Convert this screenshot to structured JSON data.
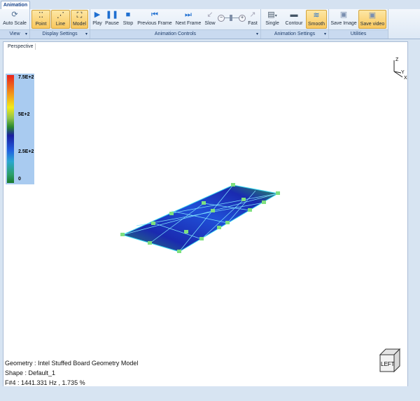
{
  "tab": {
    "label": "Animation"
  },
  "groups": {
    "view": {
      "label": "View",
      "auto_scale": "Auto Scale"
    },
    "display": {
      "label": "Display Settings",
      "point": "Point",
      "line": "Line",
      "model": "Model"
    },
    "animation": {
      "label": "Animation Controls",
      "play": "Play",
      "pause": "Pause",
      "stop": "Stop",
      "previous": "Previous Frame",
      "next": "Next Frame",
      "slow": "Slow",
      "fast": "Fast"
    },
    "anim_settings": {
      "label": "Animation Settings",
      "single": "Single",
      "contour": "Contour",
      "smooth": "Smooth"
    },
    "utilities": {
      "label": "Utilities",
      "save_image": "Save Image",
      "save_video": "Save video"
    }
  },
  "viewport": {
    "tab": "Perspective"
  },
  "legend": {
    "ticks": [
      "7.5E+2",
      "5E+2",
      "2.5E+2",
      "0"
    ]
  },
  "axes": {
    "z": "Z",
    "y": "Y",
    "x": "X"
  },
  "cube": {
    "face": "LEFT"
  },
  "info": {
    "geometry": "Geometry : Intel Stuffed Board Geometry Model",
    "shape": "Shape : Default_1",
    "frequency": "F#4 : 1441.331 Hz , 1.735 %"
  },
  "colors": {
    "active": "#f9c85e",
    "accent": "#1f6fd1"
  }
}
